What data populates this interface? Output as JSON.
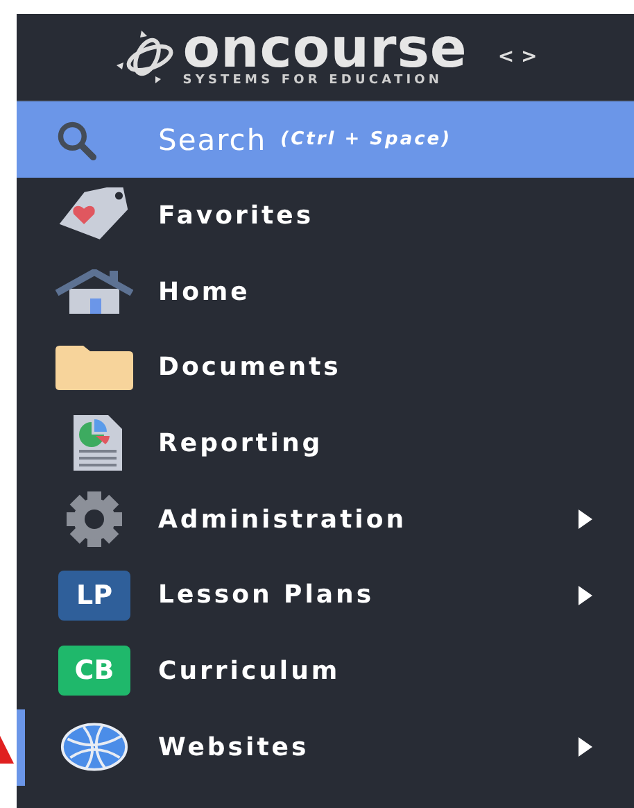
{
  "header": {
    "logo_name": "oncourse",
    "logo_tagline": "SYSTEMS FOR EDUCATION",
    "toggle": "< >"
  },
  "search": {
    "label": "Search",
    "shortcut": "(Ctrl + Space)"
  },
  "items": [
    {
      "label": "Favorites",
      "kind": "tag",
      "has_submenu": false,
      "selected": false
    },
    {
      "label": "Home",
      "kind": "house",
      "has_submenu": false,
      "selected": false
    },
    {
      "label": "Documents",
      "kind": "folder",
      "has_submenu": false,
      "selected": false
    },
    {
      "label": "Reporting",
      "kind": "report",
      "has_submenu": false,
      "selected": false
    },
    {
      "label": "Administration",
      "kind": "gear",
      "has_submenu": true,
      "selected": false
    },
    {
      "label": "Lesson Plans",
      "kind": "badge",
      "badge": "LP",
      "color": "#2f5f9a",
      "has_submenu": true,
      "selected": false
    },
    {
      "label": "Curriculum",
      "kind": "badge",
      "badge": "CB",
      "color": "#1fb86b",
      "has_submenu": false,
      "selected": false
    },
    {
      "label": "Websites",
      "kind": "globe",
      "has_submenu": true,
      "selected": true
    }
  ]
}
